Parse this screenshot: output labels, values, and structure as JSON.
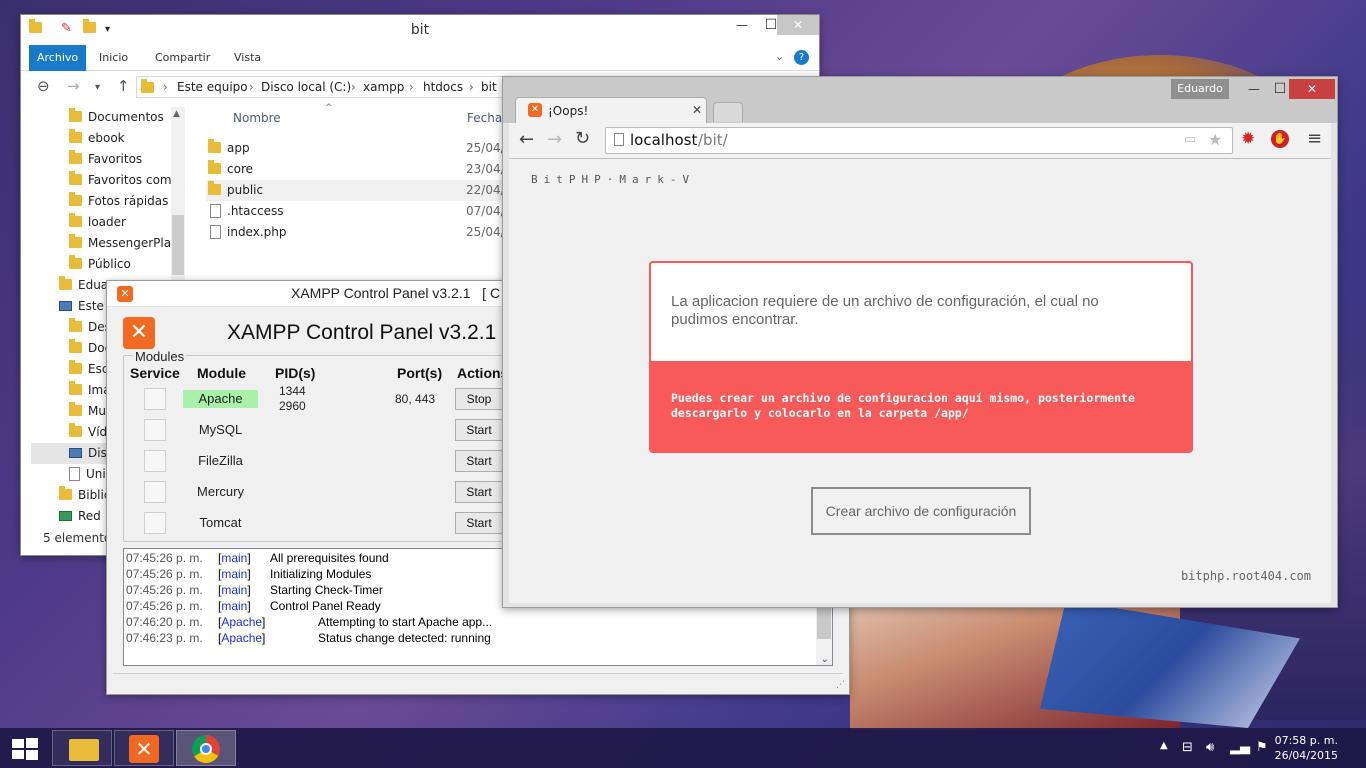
{
  "explorer": {
    "title": "bit",
    "ribbon_tabs": [
      "Archivo",
      "Inicio",
      "Compartir",
      "Vista"
    ],
    "breadcrumb": [
      "Este equipo",
      "Disco local (C:)",
      "xampp",
      "htdocs",
      "bit"
    ],
    "tree": [
      "Documentos",
      "ebook",
      "Favoritos",
      "Favoritos comp",
      "Fotos rápidas",
      "loader",
      "MessengerPlay",
      "Público",
      "Edua",
      "Este e",
      "Des",
      "Doc",
      "Esc",
      "Ima",
      "Mu",
      "Víd",
      "Dis",
      "Uni",
      "Biblic",
      "Red"
    ],
    "columns": {
      "name": "Nombre",
      "date": "Fecha d"
    },
    "files": [
      {
        "name": "app",
        "type": "folder",
        "date": "25/04/2"
      },
      {
        "name": "core",
        "type": "folder",
        "date": "23/04/2"
      },
      {
        "name": "public",
        "type": "folder",
        "date": "22/04/2"
      },
      {
        "name": ".htaccess",
        "type": "file",
        "date": "07/04/2"
      },
      {
        "name": "index.php",
        "type": "file",
        "date": "25/04/2"
      }
    ],
    "status": "5 elementos"
  },
  "xampp": {
    "window_title": "XAMPP Control Panel v3.2.1   [ C",
    "heading": "XAMPP Control Panel v3.2.1",
    "group_label": "Modules",
    "headers": {
      "service": "Service",
      "module": "Module",
      "pid": "PID(s)",
      "port": "Port(s)",
      "actions": "Actions"
    },
    "modules": [
      {
        "name": "Apache",
        "pid1": "1344",
        "pid2": "2960",
        "port": "80, 443",
        "action": "Stop",
        "running": true
      },
      {
        "name": "MySQL",
        "pid1": "",
        "pid2": "",
        "port": "",
        "action": "Start",
        "running": false
      },
      {
        "name": "FileZilla",
        "pid1": "",
        "pid2": "",
        "port": "",
        "action": "Start",
        "running": false
      },
      {
        "name": "Mercury",
        "pid1": "",
        "pid2": "",
        "port": "",
        "action": "Start",
        "running": false
      },
      {
        "name": "Tomcat",
        "pid1": "",
        "pid2": "",
        "port": "",
        "action": "Start",
        "running": false
      }
    ],
    "log": [
      {
        "time": "07:45:26 p. m.",
        "src": "main",
        "msg": "All prerequisites found"
      },
      {
        "time": "07:45:26 p. m.",
        "src": "main",
        "msg": "Initializing Modules"
      },
      {
        "time": "07:45:26 p. m.",
        "src": "main",
        "msg": "Starting Check-Timer"
      },
      {
        "time": "07:45:26 p. m.",
        "src": "main",
        "msg": "Control Panel Ready"
      },
      {
        "time": "07:46:20 p. m.",
        "src": "Apache",
        "msg": "Attempting to start Apache app..."
      },
      {
        "time": "07:46:23 p. m.",
        "src": "Apache",
        "msg": "Status change detected: running"
      }
    ]
  },
  "chrome": {
    "user": "Eduardo",
    "tab_title": "¡Oops!",
    "url_host": "localhost",
    "url_path": "/bit/",
    "page": {
      "brand": "BitPHP·Mark-V",
      "message": "La aplicacion requiere de un archivo de configuración, el cual no pudimos encontrar.",
      "hint": "Puedes crear un archivo de configuracion aquí mismo, posteriormente descargarlo y colocarlo en la carpeta",
      "hint_path": "/app/",
      "button": "Crear archivo de configuración",
      "footer": "bitphp.root404.com"
    }
  },
  "taskbar": {
    "time": "07:58 p. m.",
    "date": "26/04/2015"
  },
  "colors": {
    "accent": "#1979ca",
    "error": "#f75a59",
    "xampp": "#f26a21",
    "running": "#a9f0a9"
  }
}
